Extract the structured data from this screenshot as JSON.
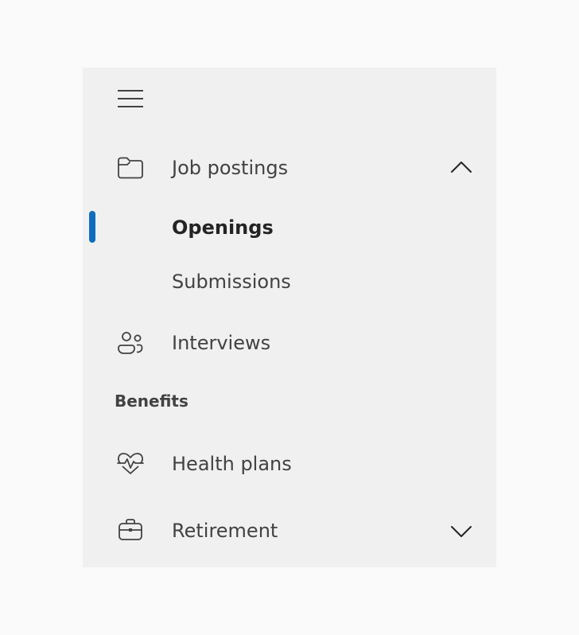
{
  "nav": {
    "menu_icon": "hamburger-menu-icon",
    "items": [
      {
        "label": "Job postings",
        "icon": "folder-icon",
        "expanded": true
      },
      {
        "label": "Openings",
        "selected": true
      },
      {
        "label": "Submissions"
      },
      {
        "label": "Interviews",
        "icon": "people-icon"
      }
    ],
    "section_header": "Benefits",
    "benefits_items": [
      {
        "label": "Health plans",
        "icon": "heart-pulse-icon"
      },
      {
        "label": "Retirement",
        "icon": "briefcase-icon",
        "expanded": false
      }
    ],
    "colors": {
      "background": "#fafafa",
      "nav_background": "#f0f0f0",
      "accent": "#0f6cbd",
      "text": "#424242"
    }
  }
}
